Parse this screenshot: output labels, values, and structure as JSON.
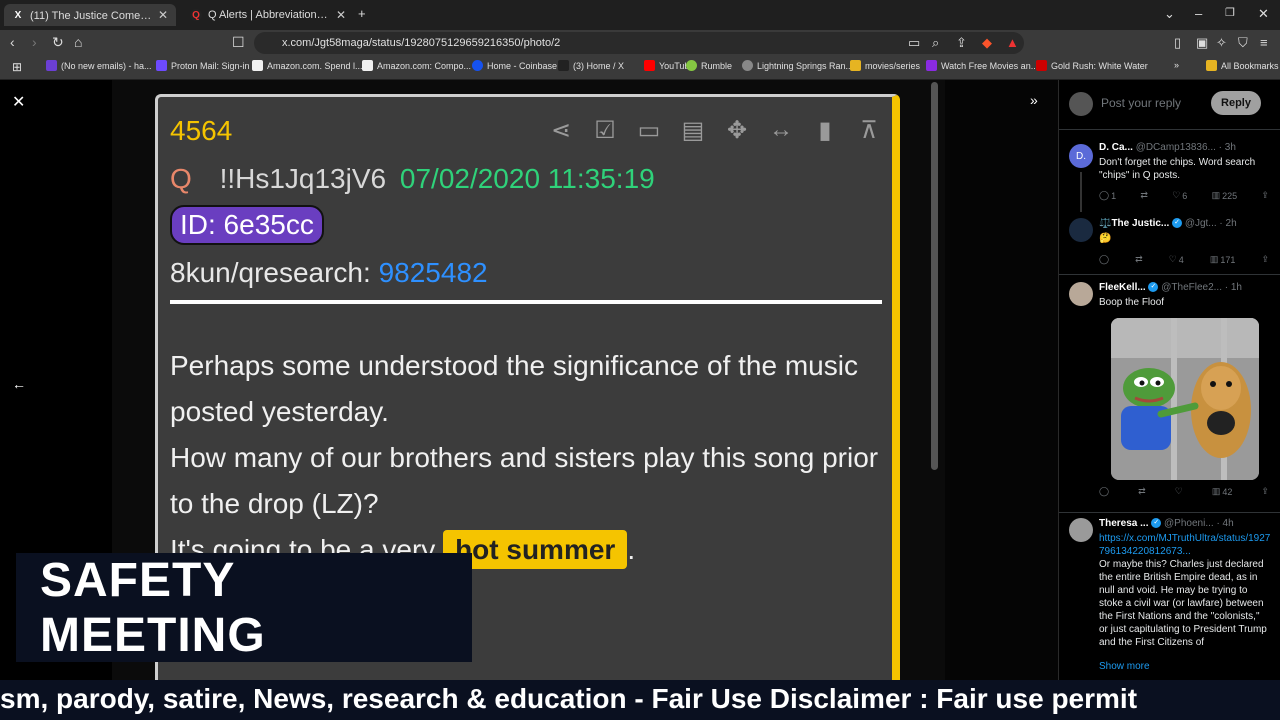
{
  "browser": {
    "tabs": [
      {
        "title": "(11) The Justice Cometh 🙏 on X",
        "favicon": "X"
      },
      {
        "title": "Q Alerts | Abbreviations, Codes, Keys & C",
        "favicon": "Q"
      }
    ],
    "new_tab": "+",
    "url": "x.com/Jgt58maga/status/1928075129659216350/photo/2",
    "bookmarks": [
      {
        "label": "(No new emails) - ha...",
        "color": "#6b3fd4"
      },
      {
        "label": "Proton Mail: Sign-in",
        "color": "#6d4aff"
      },
      {
        "label": "Amazon.com. Spend l...",
        "color": "#f0f0f0"
      },
      {
        "label": "Amazon.com: Compo...",
        "color": "#f0f0f0"
      },
      {
        "label": "Home - Coinbase",
        "color": "#1652f0"
      },
      {
        "label": "(3) Home / X",
        "color": "#222"
      },
      {
        "label": "YouTube",
        "color": "#ff0000"
      },
      {
        "label": "Rumble",
        "color": "#85c742"
      },
      {
        "label": "Lightning Springs Ran...",
        "color": "#888"
      },
      {
        "label": "movies/series",
        "color": "#e6b422"
      },
      {
        "label": "Watch Free Movies an...",
        "color": "#8a2be2"
      },
      {
        "label": "Gold Rush: White Water",
        "color": "#c00"
      }
    ],
    "all_bookmarks": "All Bookmarks"
  },
  "qpost": {
    "number": "4564",
    "letter": "Q",
    "tripcode": "!!Hs1Jq13jV6",
    "datetime": "07/02/2020 11:35:19",
    "id": "ID: 6e35cc",
    "board_prefix": "8kun/qresearch: ",
    "board_link": "9825482",
    "body_1": "Perhaps some understood the significance of the music posted yesterday.",
    "body_2": "How many of our brothers and sisters play this song prior to the drop (LZ)?",
    "body_3_prefix": "It's going to be a very ",
    "body_3_highlight": "hot summer",
    "body_3_suffix": "."
  },
  "overlay": {
    "title": "SAFETY MEETING"
  },
  "sidebar": {
    "reply_placeholder": "Post your reply",
    "reply_button": "Reply",
    "posts": [
      {
        "name": "D. Ca...",
        "handle": "@DCamp13836...",
        "time": "· 3h",
        "text": "Don't forget the chips. Word search \"chips\" in Q posts.",
        "replies": "1",
        "likes": "6",
        "views": "225",
        "avatar_letter": "D.",
        "avatar_color": "#5b6ad8"
      },
      {
        "name": "⚖️The Justic...",
        "handle": "@Jgt...",
        "time": "· 2h",
        "text": "🤔",
        "replies": "",
        "likes": "4",
        "views": "171",
        "avatar_color": "#1a2a40"
      },
      {
        "name": "FleeKell...",
        "handle": "@TheFlee2...",
        "time": "· 1h",
        "text": "Boop the Floof",
        "replies": "",
        "likes": "",
        "views": "42",
        "avatar_color": "#b8a898"
      },
      {
        "name": "Theresa ...",
        "handle": "@Phoeni...",
        "time": "· 4h",
        "link": "https://x.com/MJTruthUltra/status/1927796134220812673...",
        "text": "Or maybe this? Charles just declared the entire British Empire dead, as in null and void. He may be trying to stoke a civil war (or lawfare) between the First Nations and the \"colonists,\" or just capitulating to President Trump and the First Citizens of",
        "show_more": "Show more",
        "avatar_color": "#9a9a9a"
      }
    ]
  },
  "ticker": {
    "text": "sm, parody, satire, News, research & education - Fair Use Disclaimer : Fair use permit"
  }
}
